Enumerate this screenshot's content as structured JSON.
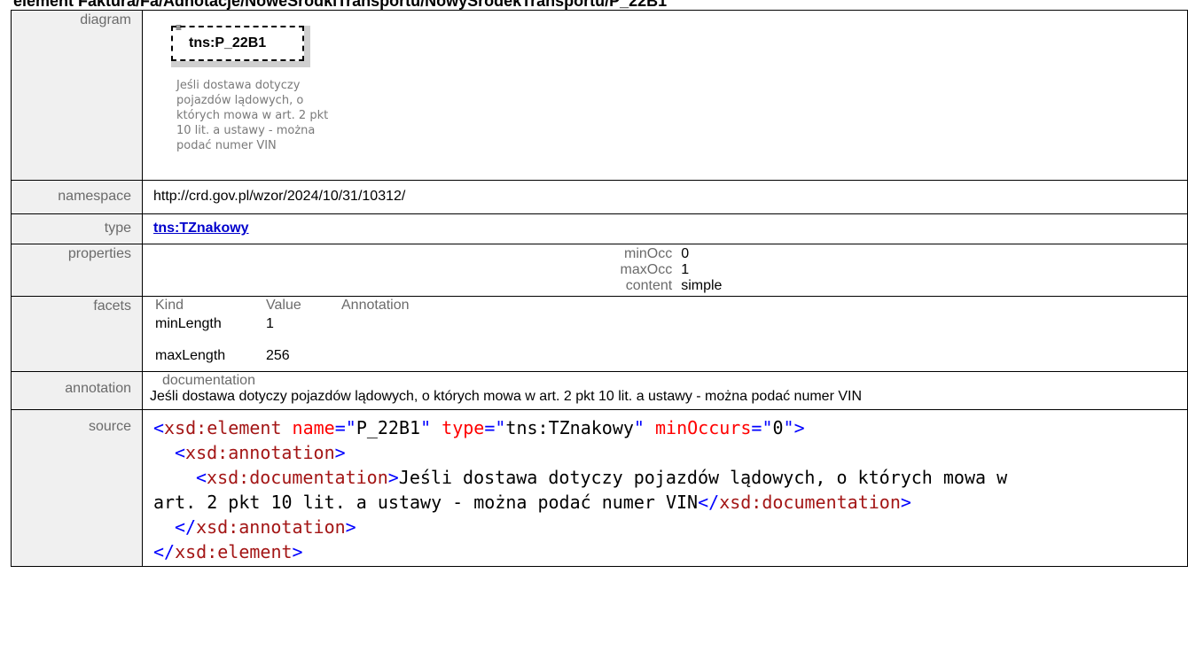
{
  "heading": "element Faktura/Fa/Adnotacje/NoweSrodkiTransportu/NowySrodekTransportu/P_22B1",
  "rows": {
    "diagram": {
      "label": "diagram",
      "element_name": "tns:P_22B1",
      "doc_lines": [
        "Jeśli dostawa dotyczy",
        "pojazdów lądowych, o",
        "których mowa w art. 2 pkt",
        "10 lit. a ustawy - można",
        "podać numer VIN"
      ]
    },
    "namespace": {
      "label": "namespace",
      "value": "http://crd.gov.pl/wzor/2024/10/31/10312/"
    },
    "type": {
      "label": "type",
      "value": "tns:TZnakowy"
    },
    "properties": {
      "label": "properties",
      "items": [
        {
          "k": "minOcc",
          "v": "0"
        },
        {
          "k": "maxOcc",
          "v": "1"
        },
        {
          "k": "content",
          "v": "simple"
        }
      ]
    },
    "facets": {
      "label": "facets",
      "headers": [
        "Kind",
        "Value",
        "Annotation"
      ],
      "rows": [
        {
          "kind": "minLength",
          "value": "1",
          "annotation": ""
        },
        {
          "kind": "maxLength",
          "value": "256",
          "annotation": ""
        }
      ]
    },
    "annotation": {
      "label": "annotation",
      "key": "documentation",
      "value": "Jeśli dostawa dotyczy pojazdów lądowych, o których mowa w art. 2 pkt 10 lit. a ustawy - można podać numer VIN"
    },
    "source": {
      "label": "source",
      "el_open": "xsd:element",
      "attr_name": "name",
      "attr_name_val": "P_22B1",
      "attr_type": "type",
      "attr_type_val": "tns:TZnakowy",
      "attr_min": "minOccurs",
      "attr_min_val": "0",
      "annotation_tag": "xsd:annotation",
      "documentation_tag": "xsd:documentation",
      "doc_text_1": "Jeśli dostawa dotyczy pojazdów lądowych, o których mowa w",
      "doc_text_2": "art. 2 pkt 10 lit. a ustawy - można podać numer VIN"
    }
  },
  "colors": {
    "label_bg": "#f0f0f0",
    "link": "#0000cc",
    "xml_tag": "#a31515",
    "xml_attr": "#ff0000",
    "xml_bracket": "#0000ff"
  }
}
